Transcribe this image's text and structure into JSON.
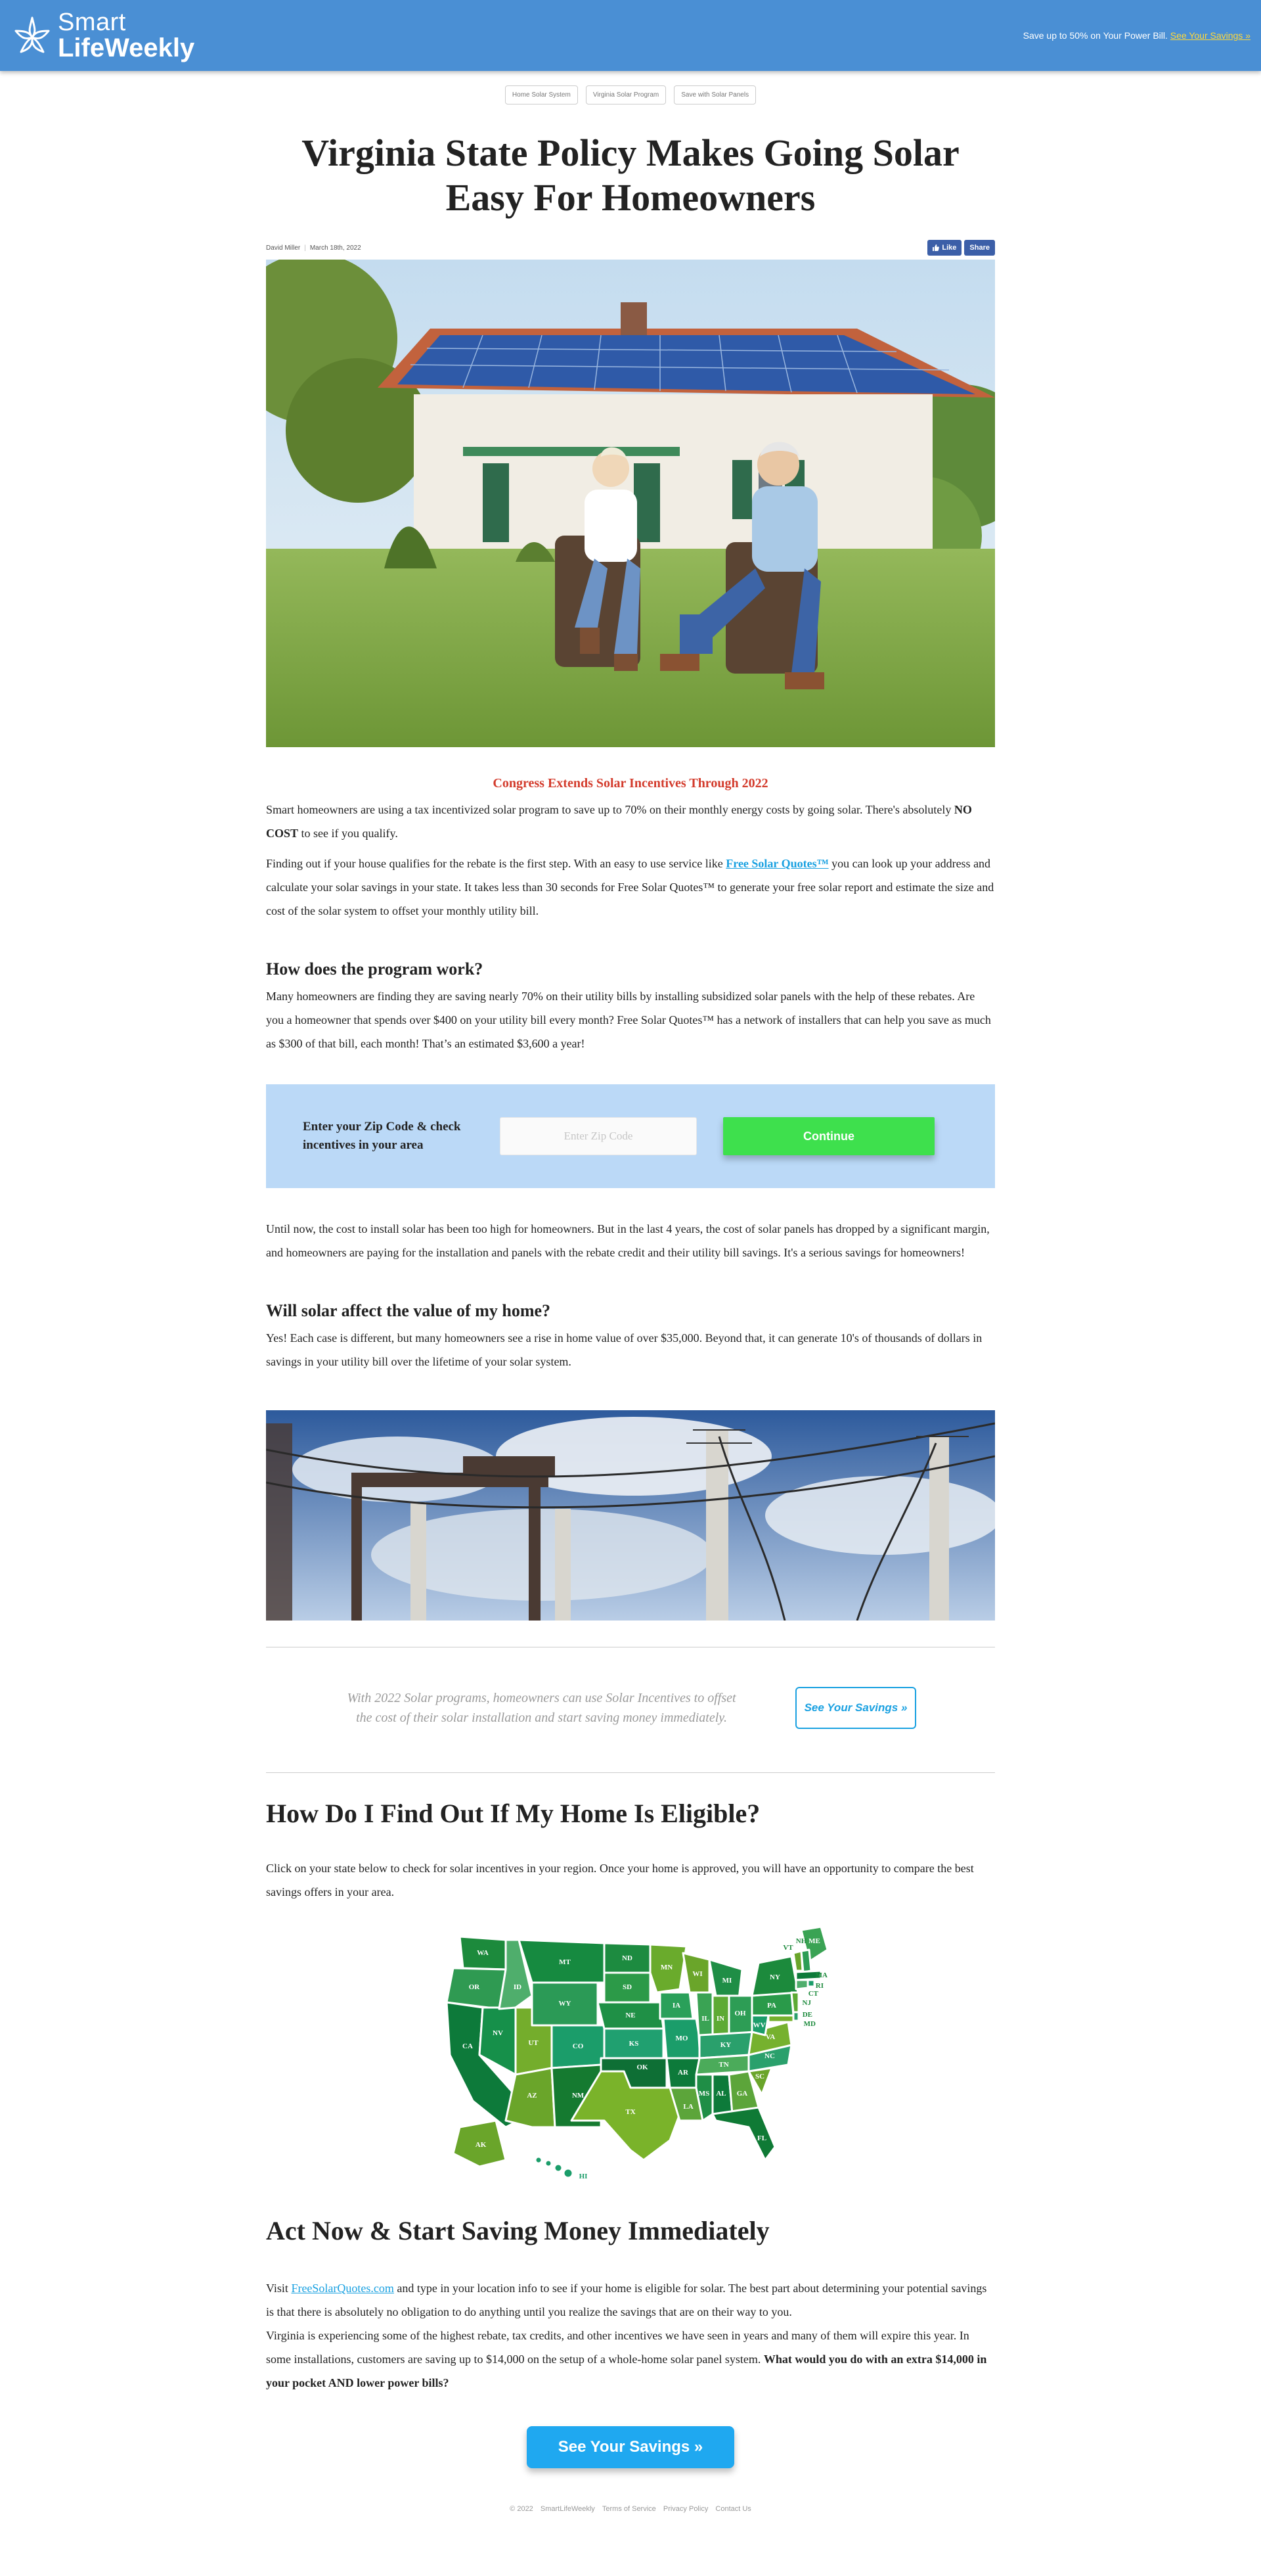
{
  "brand": {
    "name_line1": "Smart",
    "name_line2": "LifeWeekly",
    "header_text": "Save up to 50% on Your Power Bill.",
    "header_link": "See Your Savings »"
  },
  "tags": [
    "Home Solar System",
    "Virginia Solar Program",
    "Save with Solar Panels"
  ],
  "title": "Virginia State Policy Makes Going Solar Easy For Homeowners",
  "meta": {
    "author": "David Miller",
    "date": "March 18th, 2022"
  },
  "social": {
    "like": "Like",
    "share": "Share"
  },
  "subhead": "Congress Extends Solar Incentives Through 2022",
  "intro": {
    "p1_a": "Smart homeowners are using a tax incentivized solar program to save up to 70% on their monthly energy costs by going solar. There's absolutely ",
    "p1_bold": "NO COST",
    "p1_b": " to see if you qualify.",
    "p2_a": "Finding out if your house qualifies for the rebate is the first step. With an easy to use service like ",
    "p2_link": "Free Solar Quotes™",
    "p2_b": " you can look up your address and calculate your solar savings in your state. It takes less than 30 seconds for Free Solar Quotes™ to generate your free solar report and estimate the size and cost of the solar system to offset your monthly utility bill."
  },
  "section1": {
    "heading": "How does the program work?",
    "body": "Many homeowners are finding they are saving nearly 70% on their utility bills by installing subsidized solar panels with the help of these rebates. Are you a homeowner that spends over $400 on your utility bill every month? Free Solar Quotes™ has a network of installers that can help you save as much as $300 of that bill, each month! That’s an estimated $3,600 a year!"
  },
  "zip": {
    "label": "Enter your Zip Code & check incentives in your area",
    "placeholder": "Enter Zip Code",
    "button": "Continue"
  },
  "para_cost": "Until now, the cost to install solar has been too high for homeowners. But in the last 4 years, the cost of solar panels has dropped by a significant margin, and homeowners are paying for the installation and panels with the rebate credit and their utility bill savings. It's a serious savings for homeowners!",
  "section2": {
    "heading": "Will solar affect the value of my home?",
    "body": "Yes! Each case is different, but many homeowners see a rise in home value of over $35,000. Beyond that, it can generate 10's of thousands of dollars in savings in your utility bill over the lifetime of your solar system."
  },
  "callout": {
    "text": "With 2022 Solar programs, homeowners can use Solar Incentives to offset the cost of their solar installation and start saving money immediately.",
    "button": "See Your Savings »"
  },
  "eligible": {
    "heading": "How Do I Find Out If My Home Is Eligible?",
    "body": "Click on your state below to check for solar incentives in your region. Once your home is approved, you will have an opportunity to compare the best savings offers in your area."
  },
  "map_states": [
    "WA",
    "OR",
    "ID",
    "MT",
    "ND",
    "SD",
    "WY",
    "NE",
    "NV",
    "UT",
    "CO",
    "KS",
    "CA",
    "AZ",
    "NM",
    "OK",
    "TX",
    "MN",
    "IA",
    "MO",
    "AR",
    "LA",
    "WI",
    "IL",
    "MI",
    "IN",
    "OH",
    "KY",
    "TN",
    "MS",
    "AL",
    "GA",
    "FL",
    "SC",
    "NC",
    "VA",
    "WV",
    "PA",
    "NY",
    "ME",
    "VT",
    "NH",
    "MA",
    "RI",
    "CT",
    "NJ",
    "DE",
    "MD",
    "AK",
    "HI"
  ],
  "act": {
    "heading": "Act Now & Start Saving Money Immediately",
    "p1_a": "Visit ",
    "p1_link": "FreeSolarQuotes.com",
    "p1_b": " and type in your location info to see if your home is eligible for solar. The best part about determining your potential savings is that there is absolutely no obligation to do anything until you realize the savings that are on their way to you.",
    "p2_a": "Virginia is experiencing some of the highest rebate, tax credits, and other incentives we have seen in years and many of them will expire this year. In some installations, customers are saving up to $14,000 on the setup of a whole-home solar panel system. ",
    "p2_bold": "What would you do with an extra $14,000 in your pocket AND lower power bills?",
    "button": "See Your Savings »"
  },
  "footer": {
    "copyright": "© 2022",
    "site": "SmartLifeWeekly",
    "terms": "Terms of Service",
    "privacy": "Privacy Policy",
    "contact": "Contact Us"
  },
  "colors": {
    "header_bg": "#4a8fd4",
    "accent_red": "#d33b2c",
    "link_blue": "#1aa1e1",
    "zip_box": "#bbd9f7",
    "continue_green": "#3ee04d",
    "cta_blue": "#1fa8f0",
    "facebook_blue": "#3c5fa8"
  },
  "icons": [
    "smart-star-logo-icon",
    "thumbs-up-icon",
    "hero-house-solar-image",
    "power-lines-image",
    "usa-map-image"
  ]
}
